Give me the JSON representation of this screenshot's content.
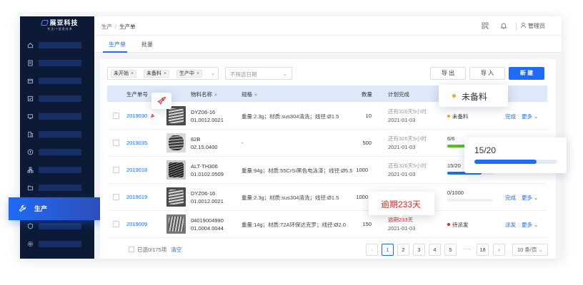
{
  "brand": {
    "title": "展亚科技",
    "subtitle": "专注IT信息技术",
    "accent": "#1f6bf5",
    "sidebar_bg": "#0c1a36"
  },
  "sidebar": {
    "items": [
      {
        "icon": "home-icon"
      },
      {
        "icon": "document-icon"
      },
      {
        "icon": "box-icon"
      },
      {
        "icon": "checklist-icon"
      },
      {
        "icon": "monitor-icon"
      },
      {
        "icon": "building-icon"
      },
      {
        "icon": "coin-icon"
      },
      {
        "icon": "network-icon"
      },
      {
        "icon": "folder-icon"
      },
      {
        "icon": "shield-icon"
      },
      {
        "icon": "gear-icon"
      }
    ],
    "active": {
      "label": "生产",
      "icon": "wrench-icon"
    }
  },
  "header": {
    "breadcrumb": [
      "生产",
      "生产单"
    ],
    "user": "管理员"
  },
  "tabs": [
    {
      "label": "生产单",
      "active": true
    },
    {
      "label": "批量",
      "active": false
    }
  ],
  "toolbar": {
    "filter_tags": [
      "未开始",
      "未备料",
      "生产中"
    ],
    "date_placeholder": "不筛选日期",
    "export_label": "导 出",
    "import_label": "导 入",
    "new_label": "新 建"
  },
  "table": {
    "columns": {
      "code": "生产单号",
      "material": "物料名称",
      "spec": "规格",
      "qty": "数量",
      "due": "计划完成"
    },
    "rows": [
      {
        "code": "2019030",
        "name": "DYZ06-16",
        "no": "01.0012.0021",
        "spec": "重量:2.3g；材质:sus304清洗；线径:Ø1.5",
        "qty": "10",
        "remain": "还有326天5小时",
        "date": "2021-01-03",
        "status": "未备料",
        "status_color": "#f5a623",
        "actions": [
          "完成",
          "更多"
        ]
      },
      {
        "code": "2019035",
        "name": "82B",
        "no": "02.15.0400",
        "spec": "-",
        "qty": "500",
        "remain": "还有326天5小时",
        "date": "2021-01-03",
        "progress": "6/6",
        "progress_ratio": 1.0,
        "progress_color": "#52c41a",
        "actions": []
      },
      {
        "code": "2019018",
        "name": "ALT-TH306",
        "no": "01.0102.0509",
        "spec": "重量:94g；材质:55CrSi黑色电泳漆；线径:Ø5.5",
        "qty": "1000",
        "remain": "还有326天5小时",
        "date": "2021-01-03",
        "progress": "15/20",
        "progress_ratio": 0.75,
        "progress_color": "#1f6bf5",
        "actions": []
      },
      {
        "code": "2019019",
        "name": "DYZ06-16",
        "no": "01.0012.0021",
        "spec": "重量:2.3g；材质:sus304清洗；线径:Ø1.5",
        "qty": "1000",
        "remain": "",
        "date": "",
        "progress": "0/1000",
        "progress_ratio": 0,
        "progress_color": "#1f6bf5",
        "actions": [
          "完成",
          "更多"
        ]
      },
      {
        "code": "2019009",
        "name": "04019004990",
        "no": "01.0004.0044",
        "spec": "重量:14g；材质:72A环保达克罗；线径:Ø2.0",
        "qty": "150",
        "remain": "逾期233天",
        "date": "2021-01-03",
        "overdue": true,
        "status": "待派发",
        "status_color": "#e02a2a",
        "actions": [
          "派发",
          "更多"
        ]
      }
    ]
  },
  "footer": {
    "selected": "已选0/175项",
    "clear": "清空",
    "pages": [
      "1",
      "2",
      "3",
      "4",
      "5",
      "18"
    ],
    "current_page": "1",
    "ellipsis": "···",
    "page_size": "10 条/页"
  },
  "popovers": {
    "status": "未备料",
    "progress": "15/20",
    "progress_ratio": 0.75,
    "overdue": "逾期233天"
  }
}
